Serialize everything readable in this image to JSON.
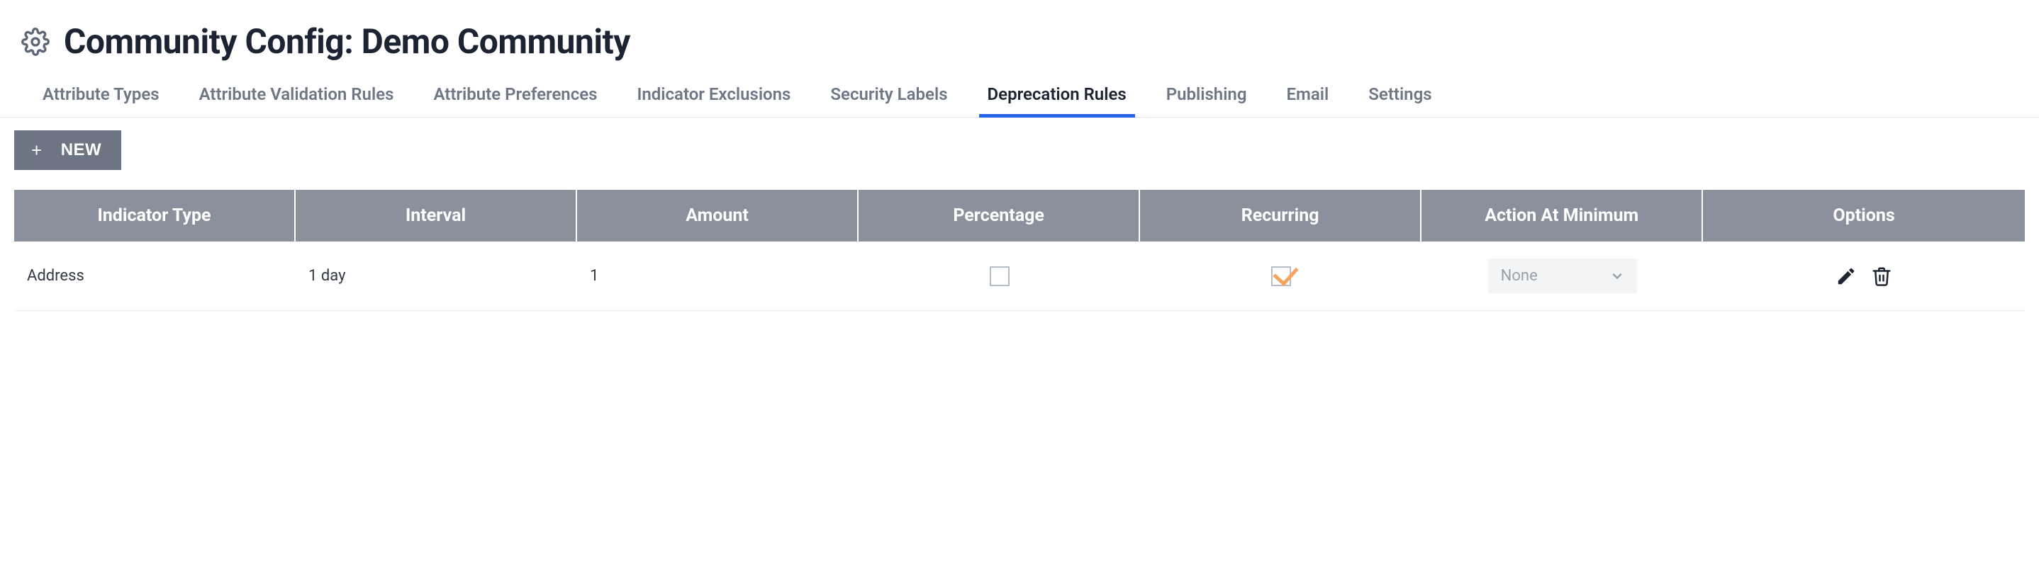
{
  "header": {
    "title": "Community Config: Demo Community"
  },
  "tabs": [
    {
      "label": "Attribute Types",
      "active": false
    },
    {
      "label": "Attribute Validation Rules",
      "active": false
    },
    {
      "label": "Attribute Preferences",
      "active": false
    },
    {
      "label": "Indicator Exclusions",
      "active": false
    },
    {
      "label": "Security Labels",
      "active": false
    },
    {
      "label": "Deprecation Rules",
      "active": true
    },
    {
      "label": "Publishing",
      "active": false
    },
    {
      "label": "Email",
      "active": false
    },
    {
      "label": "Settings",
      "active": false
    }
  ],
  "toolbar": {
    "new_label": "NEW"
  },
  "table": {
    "headers": {
      "indicator_type": "Indicator Type",
      "interval": "Interval",
      "amount": "Amount",
      "percentage": "Percentage",
      "recurring": "Recurring",
      "action_at_minimum": "Action At Minimum",
      "options": "Options"
    },
    "rows": [
      {
        "indicator_type": "Address",
        "interval": "1 day",
        "amount": "1",
        "percentage_checked": false,
        "recurring_checked": true,
        "action_at_minimum": "None"
      }
    ]
  }
}
